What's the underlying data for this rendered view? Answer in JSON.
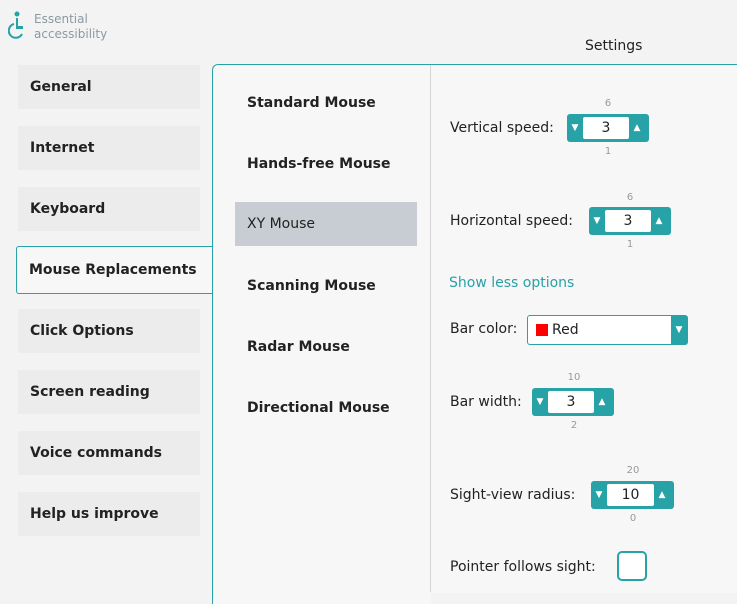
{
  "app": {
    "logo_line1": "Essential",
    "logo_line2": "accessibility",
    "title": "Settings"
  },
  "categories": [
    {
      "label": "General"
    },
    {
      "label": "Internet"
    },
    {
      "label": "Keyboard"
    },
    {
      "label": "Mouse Replacements",
      "active": true
    },
    {
      "label": "Click Options"
    },
    {
      "label": "Screen reading"
    },
    {
      "label": "Voice commands"
    },
    {
      "label": "Help us improve"
    }
  ],
  "subcategories": [
    {
      "label": "Standard Mouse"
    },
    {
      "label": "Hands-free Mouse"
    },
    {
      "label": "XY Mouse",
      "active": true
    },
    {
      "label": "Scanning Mouse"
    },
    {
      "label": "Radar Mouse"
    },
    {
      "label": "Directional Mouse"
    }
  ],
  "settings": {
    "vertical_speed": {
      "label": "Vertical speed:",
      "value": "3",
      "max": "6",
      "min": "1"
    },
    "horizontal_speed": {
      "label": "Horizontal speed:",
      "value": "3",
      "max": "6",
      "min": "1"
    },
    "show_less": "Show less options",
    "bar_color": {
      "label": "Bar color:",
      "value": "Red",
      "color": "#ff0000"
    },
    "bar_width": {
      "label": "Bar width:",
      "value": "3",
      "max": "10",
      "min": "2"
    },
    "sight_radius": {
      "label": "Sight-view radius:",
      "value": "10",
      "max": "20",
      "min": "0"
    },
    "pointer_follows": {
      "label": "Pointer follows sight:",
      "checked": false
    }
  },
  "colors": {
    "accent": "#27a2a7",
    "selected_item": "#c8cdd3"
  },
  "icons": {
    "logo": "wheelchair-icon",
    "spin_down": "triangle-down-icon",
    "spin_up": "triangle-up-icon",
    "dropdown": "triangle-down-icon"
  }
}
